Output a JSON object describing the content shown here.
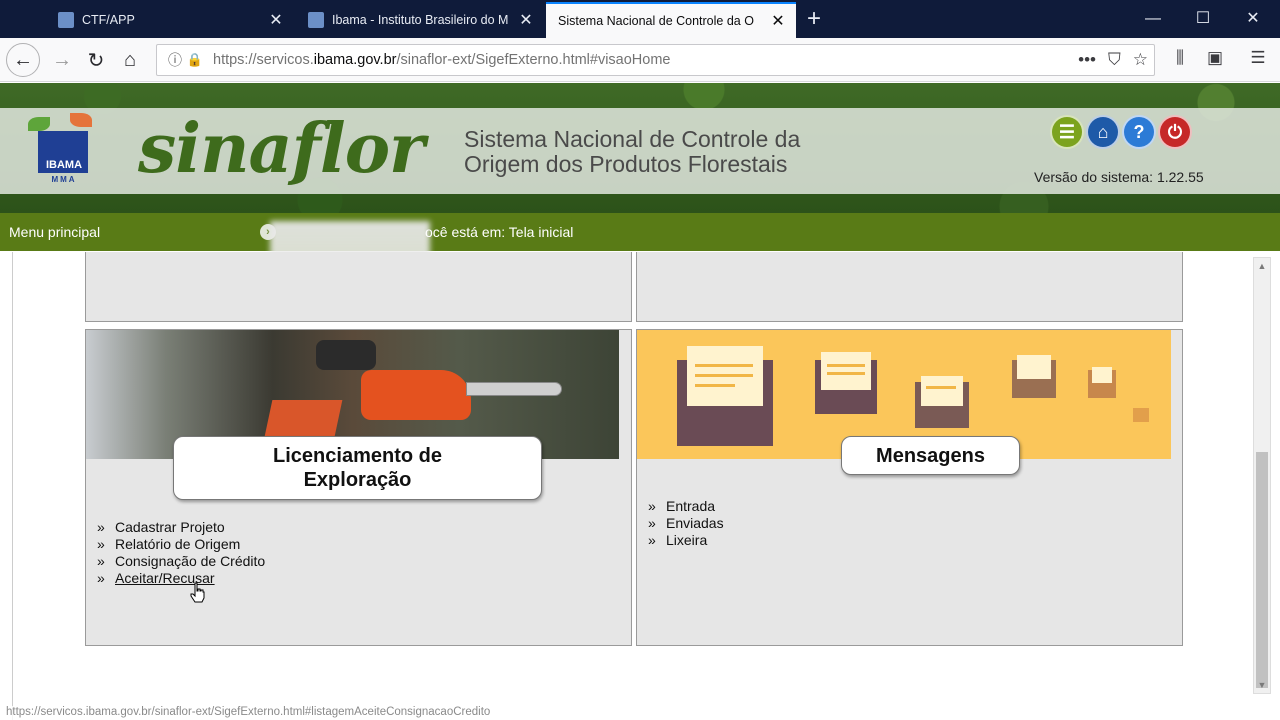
{
  "browser": {
    "tabs": [
      {
        "title": "CTF/APP",
        "active": false
      },
      {
        "title": "Ibama - Instituto Brasileiro do M",
        "active": false
      },
      {
        "title": "Sistema Nacional de Controle da O",
        "active": true
      }
    ],
    "url_prefix": "https://servicos.",
    "url_host": "ibama.gov.br",
    "url_path": "/sinaflor-ext/SigefExterno.html#visaoHome",
    "status_url": "https://servicos.ibama.gov.br/sinaflor-ext/SigefExterno.html#listagemAceiteConsignacaoCredito"
  },
  "header": {
    "ibama_logo": "IBAMA",
    "ibama_mma": "MMA",
    "logo_text": "sinaflor",
    "system_title_line1": "Sistema Nacional de Controle da",
    "system_title_line2": "Origem dos Produtos Florestais",
    "version": "Versão do sistema: 1.22.55",
    "icons": [
      "list-icon",
      "home-icon",
      "help-icon",
      "power-icon"
    ]
  },
  "menu": {
    "main_label": "Menu principal",
    "location": "ocê está em: Tela inicial"
  },
  "cards": {
    "licenciamento": {
      "title_line1": "Licenciamento de",
      "title_line2": "Exploração",
      "items": [
        "Cadastrar Projeto",
        "Relatório de Origem",
        "Consignação de Crédito",
        "Aceitar/Recusar"
      ]
    },
    "mensagens": {
      "title": "Mensagens",
      "items": [
        "Entrada",
        "Enviadas",
        "Lixeira"
      ]
    }
  },
  "bullet": "»",
  "colors": {
    "menu_green": "#597b16",
    "card_bg": "#e6e6e6",
    "mail_bg": "#fbc65a",
    "tabbar": "#0f1b3a"
  }
}
